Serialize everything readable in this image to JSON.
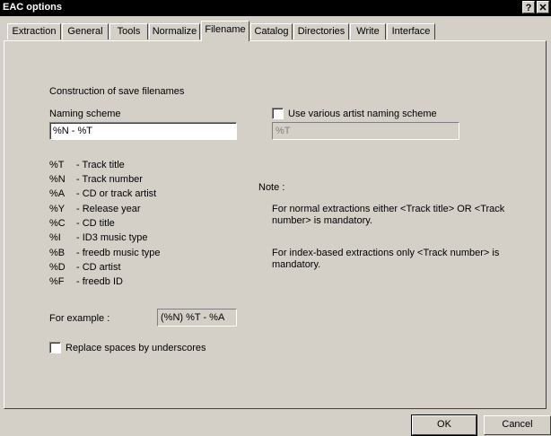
{
  "window": {
    "title": "EAC options",
    "help_btn": "?",
    "close_btn": "✕"
  },
  "tabs": [
    {
      "label": "Extraction"
    },
    {
      "label": "General"
    },
    {
      "label": "Tools"
    },
    {
      "label": "Normalize"
    },
    {
      "label": "Filename",
      "active": true
    },
    {
      "label": "Catalog"
    },
    {
      "label": "Directories"
    },
    {
      "label": "Write"
    },
    {
      "label": "Interface"
    }
  ],
  "filename": {
    "section_title": "Construction of save filenames",
    "naming_scheme_label": "Naming scheme",
    "naming_scheme_value": "%N - %T",
    "various_artist_label": "Use various artist naming scheme",
    "various_artist_checked": false,
    "various_artist_value": "%T",
    "legend": [
      {
        "code": "%T",
        "desc": "- Track title"
      },
      {
        "code": "%N",
        "desc": "- Track number"
      },
      {
        "code": "%A",
        "desc": "- CD or track artist"
      },
      {
        "code": "%Y",
        "desc": "- Release year"
      },
      {
        "code": "%C",
        "desc": "- CD title"
      },
      {
        "code": "%I",
        "desc": "- ID3 music type"
      },
      {
        "code": "%B",
        "desc": "- freedb music type"
      },
      {
        "code": "%D",
        "desc": "- CD artist"
      },
      {
        "code": "%F",
        "desc": "- freedb ID"
      }
    ],
    "example_label": "For example :",
    "example_value": "(%N) %T - %A",
    "replace_spaces_label": "Replace spaces by underscores",
    "replace_spaces_checked": false,
    "note_title": "Note :",
    "note_1": "For normal extractions either <Track title>  OR  <Track number> is mandatory.",
    "note_2": "For index-based extractions only <Track number> is mandatory."
  },
  "buttons": {
    "ok": "OK",
    "cancel": "Cancel"
  },
  "colors": {
    "face": "#d4d0c8",
    "titlebar": "#000000"
  }
}
